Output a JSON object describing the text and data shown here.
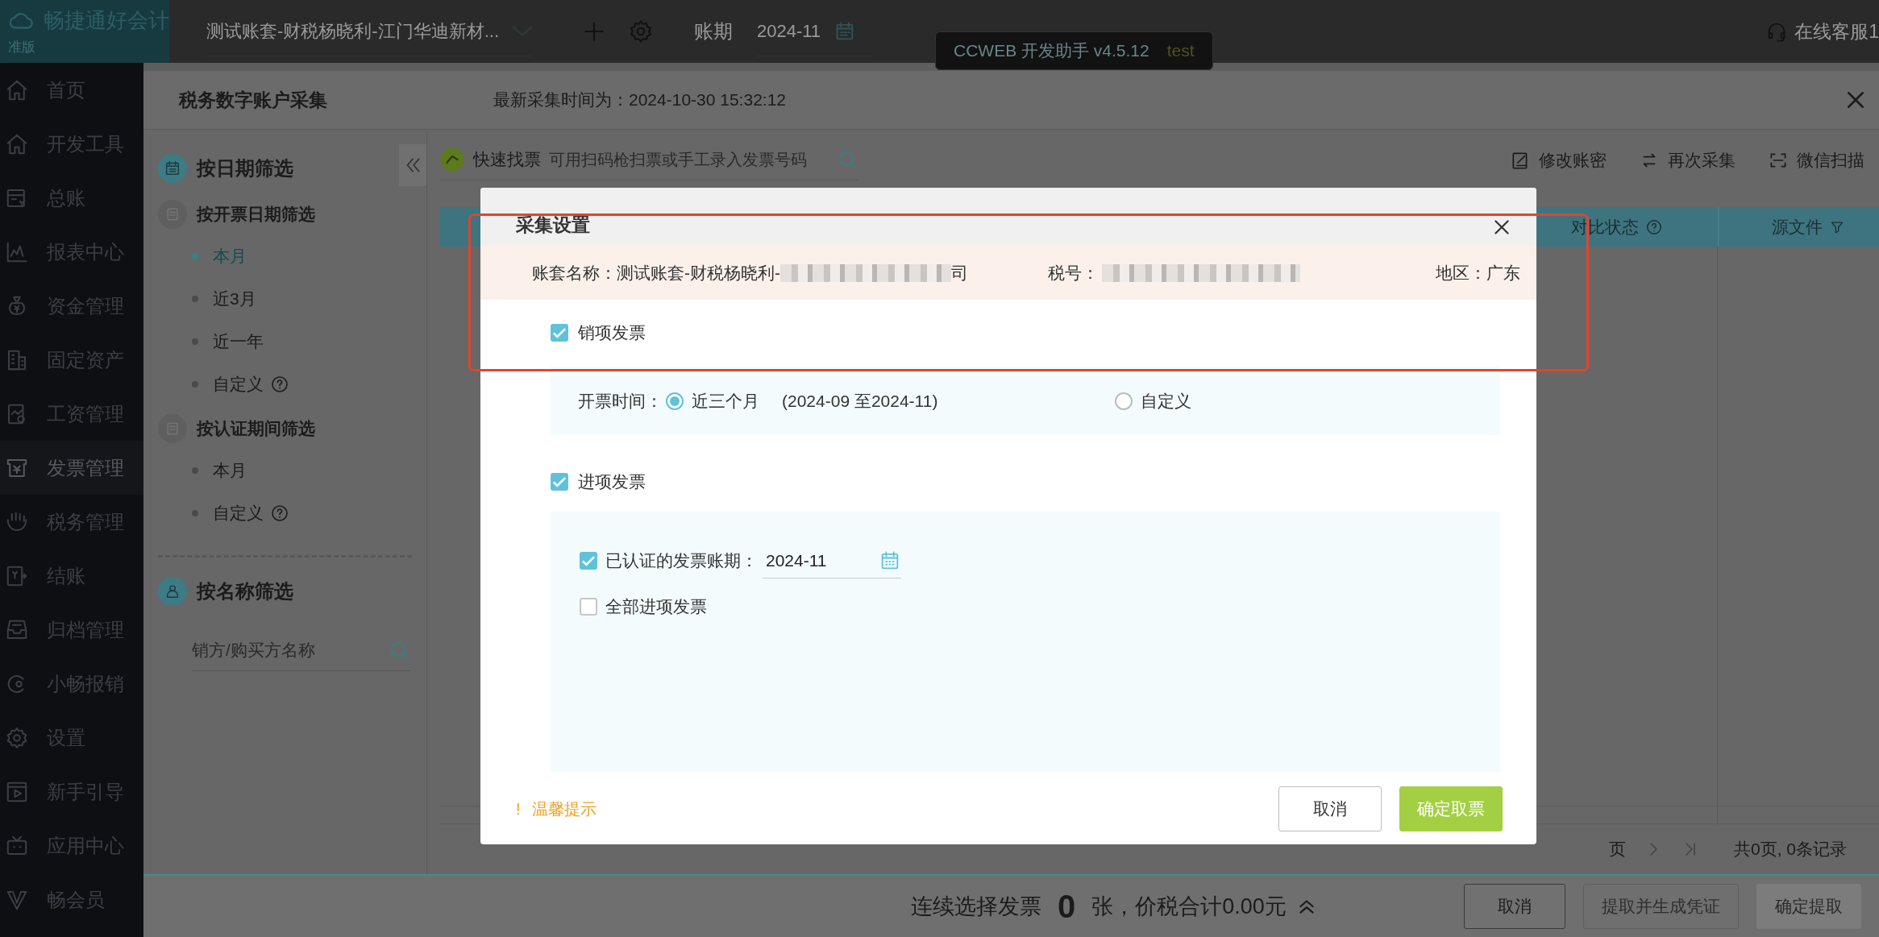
{
  "app": {
    "logo": "畅捷通好会计",
    "edition": "准版"
  },
  "topbar": {
    "account_set": "测试账套-财税杨晓利-江门华迪新材...",
    "period_label": "账期",
    "period": "2024-11",
    "dev_badge": {
      "name": "CCWEB 开发助手 v4.5.12",
      "env": "test"
    },
    "support": "在线客服1"
  },
  "sidebar": {
    "items": [
      {
        "label": "首页",
        "selected": false
      },
      {
        "label": "开发工具",
        "selected": false
      },
      {
        "label": "总账",
        "selected": false
      },
      {
        "label": "报表中心",
        "selected": false
      },
      {
        "label": "资金管理",
        "selected": false
      },
      {
        "label": "固定资产",
        "selected": false
      },
      {
        "label": "工资管理",
        "selected": false
      },
      {
        "label": "发票管理",
        "selected": true
      },
      {
        "label": "税务管理",
        "selected": false
      },
      {
        "label": "结账",
        "selected": false
      },
      {
        "label": "归档管理",
        "selected": false
      },
      {
        "label": "小畅报销",
        "selected": false
      },
      {
        "label": "设置",
        "selected": false
      },
      {
        "label": "新手引导",
        "selected": false
      },
      {
        "label": "应用中心",
        "selected": false
      },
      {
        "label": "畅会员",
        "selected": false
      }
    ]
  },
  "panel": {
    "title": "税务数字账户采集",
    "latest": "最新采集时间为：2024-10-30 15:32:12",
    "date_filter": {
      "title": "按日期筛选",
      "groups": [
        {
          "title": "按开票日期筛选",
          "options": [
            {
              "label": "本月",
              "selected": true,
              "help": false
            },
            {
              "label": "近3月",
              "selected": false,
              "help": false
            },
            {
              "label": "近一年",
              "selected": false,
              "help": false
            },
            {
              "label": "自定义",
              "selected": false,
              "help": true
            }
          ]
        },
        {
          "title": "按认证期间筛选",
          "options": [
            {
              "label": "本月",
              "selected": false,
              "help": false
            },
            {
              "label": "自定义",
              "selected": false,
              "help": true
            }
          ]
        }
      ]
    },
    "name_filter": {
      "title": "按名称筛选",
      "placeholder": "销方/购买方名称"
    },
    "quick_find": {
      "label": "快速找票",
      "placeholder": "可用扫码枪扫票或手工录入发票号码"
    },
    "tools": [
      {
        "label": "修改账密"
      },
      {
        "label": "再次采集"
      },
      {
        "label": "微信扫描"
      }
    ],
    "table": {
      "columns": [
        {
          "label": "对比状态",
          "help": true
        },
        {
          "label": "源文件",
          "help": false
        }
      ]
    },
    "pagination": {
      "page_suffix": "页",
      "summary": "共0页, 0条记录"
    },
    "footer": {
      "prefix": "连续选择发票",
      "count": "0",
      "suffix": "张，价税合计0.00元",
      "buttons": [
        {
          "label": "取消",
          "kind": "secondary"
        },
        {
          "label": "提取并生成凭证",
          "kind": "disabled"
        },
        {
          "label": "确定提取",
          "kind": "primary-disabled"
        }
      ]
    }
  },
  "dialog": {
    "title": "采集设置",
    "info": {
      "account_label": "账套名称：",
      "account_start": "测试账套-财税杨晓利-",
      "account_end": "司",
      "tax_label": "税号：",
      "region": "地区：广东"
    },
    "sales": {
      "label": "销项发票",
      "checked": true,
      "time_label": "开票时间：",
      "options": [
        {
          "label": "近三个月",
          "note": "(2024-09 至2024-11)",
          "selected": true
        },
        {
          "label": "自定义",
          "selected": false
        }
      ]
    },
    "purchase": {
      "label": "进项发票",
      "checked": true,
      "rows": [
        {
          "kind": "period",
          "label": "已认证的发票账期：",
          "checked": true,
          "value": "2024-11"
        },
        {
          "kind": "plain",
          "label": "全部进项发票",
          "checked": false
        }
      ]
    },
    "tip": {
      "mark": "!",
      "text": "温馨提示"
    },
    "buttons": [
      {
        "label": "取消",
        "kind": "secondary"
      },
      {
        "label": "确定取票",
        "kind": "primary"
      }
    ]
  }
}
